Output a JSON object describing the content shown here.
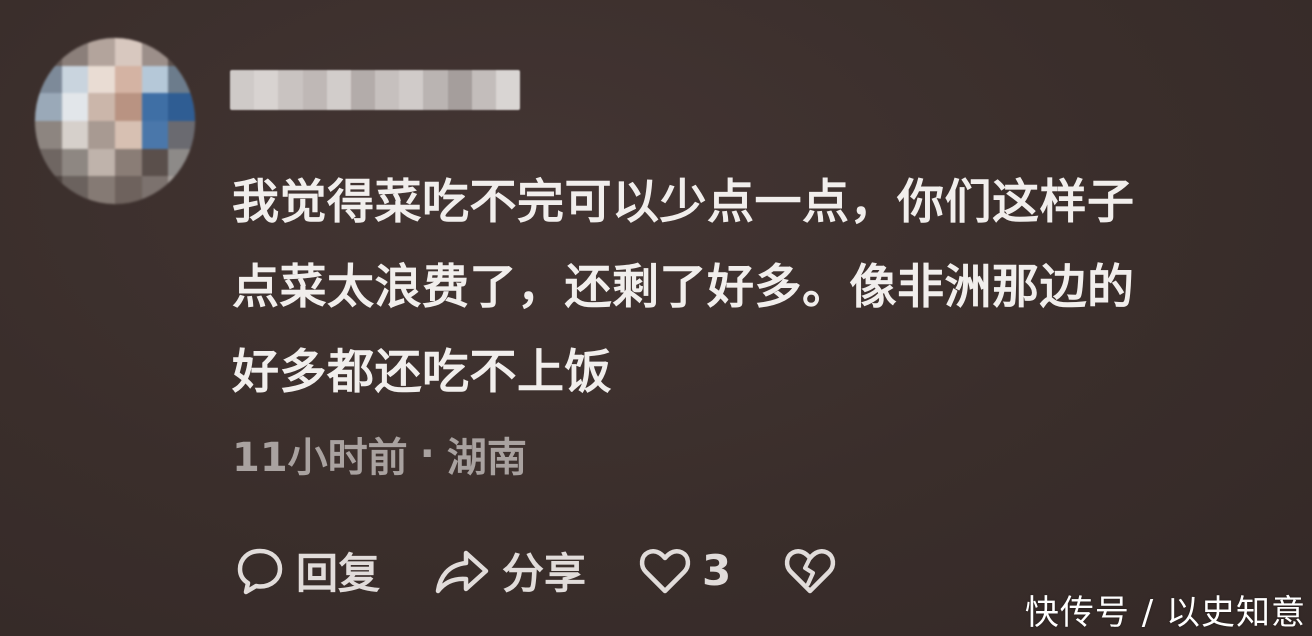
{
  "comment": {
    "lines": [
      "我觉得菜吃不完可以少点一点，你们这样子",
      "点菜太浪费了，还剩了好多。像非洲那边的",
      "好多都还吃不上饭"
    ],
    "time": "11小时前",
    "separator": "·",
    "location": "湖南"
  },
  "actions": {
    "reply_label": "回复",
    "share_label": "分享",
    "like_count": "3",
    "reply_icon": "chat-bubble-icon",
    "share_icon": "share-arrow-icon",
    "like_icon": "heart-icon",
    "dislike_icon": "broken-heart-icon"
  },
  "watermark": "快传号 / 以史知意",
  "colors": {
    "background": "#3a2e2b",
    "comment_text": "#f1eeec",
    "meta_text": "#a9a2a0",
    "action_text": "#e1dcda"
  }
}
